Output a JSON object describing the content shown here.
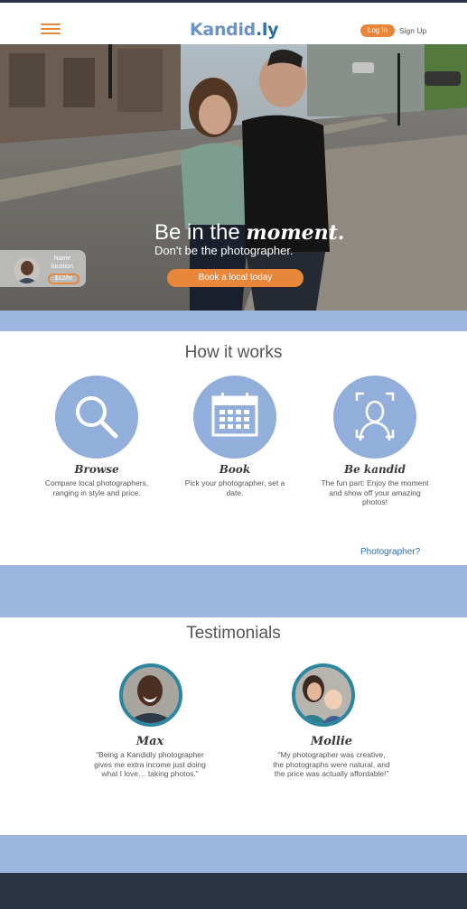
{
  "header": {
    "logo_part1": "Kandid",
    "logo_part2": ".ly",
    "login_label": "Log In",
    "signup_label": "Sign Up",
    "menu_icon": "hamburger-menu-icon"
  },
  "hero": {
    "title_plain": "Be in the ",
    "title_accent": "moment.",
    "subtitle": "Don't be the photographer.",
    "cta_label": "Book a local today"
  },
  "photographer_card": {
    "name": "Name",
    "location": "location",
    "price": "$12/hr"
  },
  "how_it_works": {
    "title": "How it works",
    "steps": [
      {
        "icon": "search-icon",
        "name": "Browse",
        "desc": "Compare local photographers, ranging in style and price."
      },
      {
        "icon": "calendar-icon",
        "name": "Book",
        "desc": "Pick your photographer, set a date."
      },
      {
        "icon": "person-focus-icon",
        "name": "Be kandid",
        "desc": "The fun part: Enjoy the moment and show off your amazing photos!"
      }
    ],
    "photographer_link": "Photographer?"
  },
  "testimonials": {
    "title": "Testimonials",
    "items": [
      {
        "name": "Max",
        "quote": "“Being a Kandidly photographer gives me extra income just doing what I love… taking photos.”"
      },
      {
        "name": "Mollie",
        "quote": "“My photographer was creative, the photographs were natural, and the price was actually affordable!”"
      }
    ]
  },
  "colors": {
    "accent": "#e8873a",
    "brand_light": "#6c93c8",
    "brand_dark": "#2d6fa8",
    "band": "#9cb6e0",
    "footer": "#2b3442"
  }
}
